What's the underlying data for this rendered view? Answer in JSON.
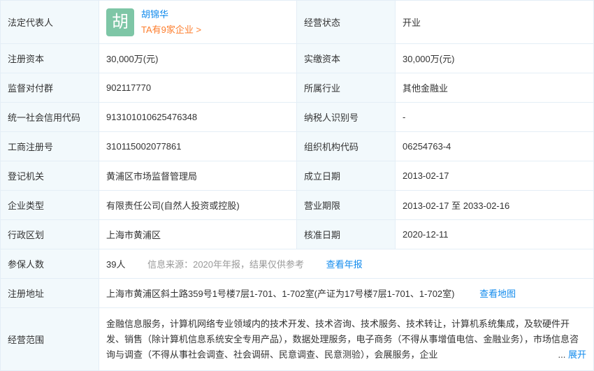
{
  "labels": {
    "legal_rep": "法定代表人",
    "status": "经营状态",
    "reg_capital": "注册资本",
    "paid_capital": "实缴资本",
    "supervisor": "监督对付群",
    "industry": "所属行业",
    "credit_code": "统一社会信用代码",
    "taxpayer_id": "纳税人识别号",
    "reg_no": "工商注册号",
    "org_code": "组织机构代码",
    "reg_authority": "登记机关",
    "est_date": "成立日期",
    "company_type": "企业类型",
    "business_term": "营业期限",
    "district": "行政区划",
    "approval_date": "核准日期",
    "insured": "参保人数",
    "reg_address": "注册地址",
    "scope": "经营范围"
  },
  "legal_rep": {
    "avatar_char": "胡",
    "avatar_color": "#7ec6a6",
    "name": "胡锦华",
    "companies_link": "TA有9家企业 >"
  },
  "values": {
    "status": "开业",
    "reg_capital": "30,000万(元)",
    "paid_capital": "30,000万(元)",
    "supervisor": "902117770",
    "industry": "其他金融业",
    "credit_code": "913101010625476348",
    "taxpayer_id": "-",
    "reg_no": "310115002077861",
    "org_code": "06254763-4",
    "reg_authority": "黄浦区市场监督管理局",
    "est_date": "2013-02-17",
    "company_type": "有限责任公司(自然人投资或控股)",
    "business_term": "2013-02-17 至 2033-02-16",
    "district": "上海市黄浦区",
    "approval_date": "2020-12-11",
    "insured_count": "39人",
    "insured_source": "信息来源：2020年年报，结果仅供参考",
    "insured_link": "查看年报",
    "reg_address": "上海市黄浦区斜土路359号1号楼7层1-701、1-702室(产证为17号楼7层1-701、1-702室)",
    "address_link": "查看地图",
    "scope": "金融信息服务，计算机网络专业领域内的技术开发、技术咨询、技术服务、技术转让，计算机系统集成，及软硬件开发、销售（除计算机信息系统安全专用产品），数据处理服务，电子商务（不得从事增值电信、金融业务），市场信息咨询与调查（不得从事社会调查、社会调研、民意调查、民意测验），会展服务，企业",
    "scope_ellipsis": "...",
    "expand_link": "展开"
  },
  "colors": {
    "label_bg": "#f2f9fc",
    "border": "#e4eef6",
    "link": "#128bed",
    "orange": "#fd7d2c"
  }
}
